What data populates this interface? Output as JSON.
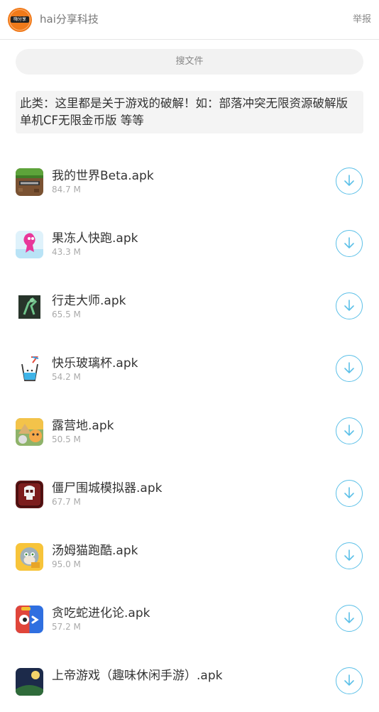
{
  "header": {
    "logo_text": "嗨分享",
    "site_name": "hai分享科技",
    "report_label": "举报"
  },
  "search": {
    "placeholder": "搜文件"
  },
  "description": "此类：这里都是关于游戏的破解！如：部落冲突无限资源破解版 单机CF无限金币版 等等",
  "files": [
    {
      "name": "我的世界Beta.apk",
      "size": "84.7 M",
      "icon": "minecraft-icon"
    },
    {
      "name": "果冻人快跑.apk",
      "size": "43.3 M",
      "icon": "jelly-run-icon"
    },
    {
      "name": "行走大师.apk",
      "size": "65.5 M",
      "icon": "walk-master-icon"
    },
    {
      "name": "快乐玻璃杯.apk",
      "size": "54.2 M",
      "icon": "happy-glass-icon"
    },
    {
      "name": "露营地.apk",
      "size": "50.5 M",
      "icon": "campsite-icon"
    },
    {
      "name": "僵尸围城模拟器.apk",
      "size": "67.7 M",
      "icon": "zombie-siege-icon"
    },
    {
      "name": "汤姆猫跑酷.apk",
      "size": "95.0 M",
      "icon": "tom-cat-run-icon"
    },
    {
      "name": "贪吃蛇进化论.apk",
      "size": "57.2 M",
      "icon": "snake-evolution-icon"
    },
    {
      "name": "上帝游戏（趣味休闲手游）.apk",
      "size": "",
      "icon": "god-game-icon"
    }
  ],
  "colors": {
    "accent": "#5cc0e8",
    "logo": "#f07a1a"
  }
}
